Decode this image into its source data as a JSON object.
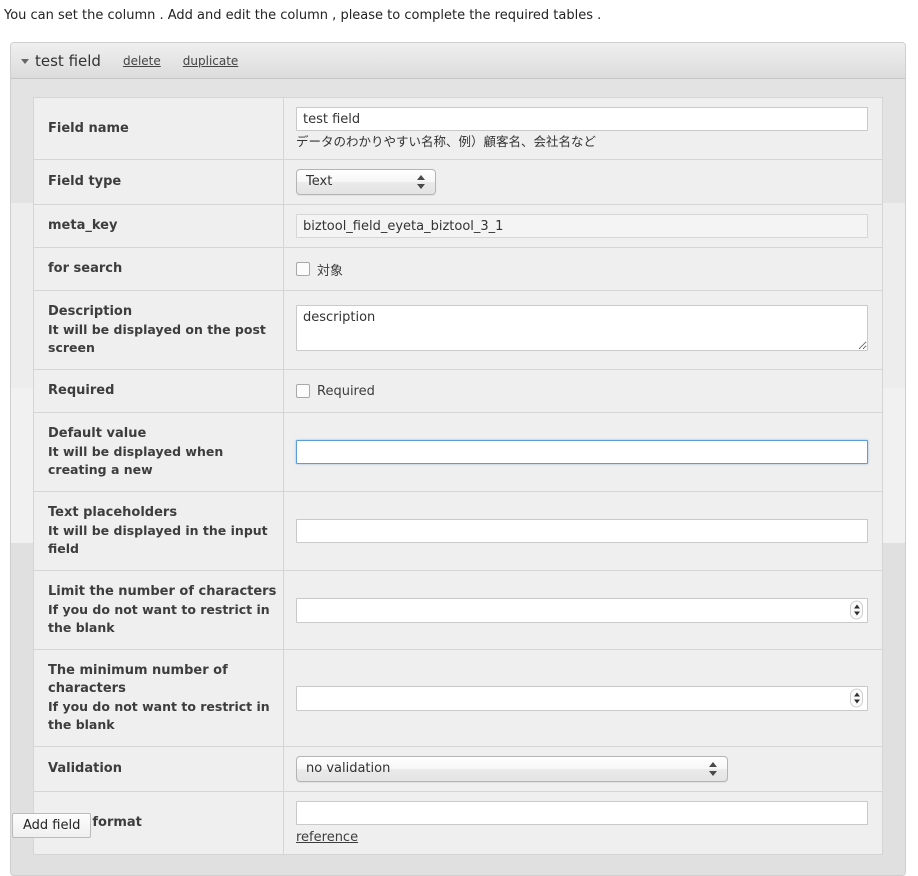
{
  "intro": "You can set the column . Add and edit the column , please to complete the required tables .",
  "panel": {
    "title": "test field",
    "delete_label": "delete",
    "duplicate_label": "duplicate"
  },
  "rows": {
    "field_name": {
      "label": "Field name",
      "value": "test field",
      "helper": "データのわかりやすい名称、例）顧客名、会社名など"
    },
    "field_type": {
      "label": "Field type",
      "selected": "Text"
    },
    "meta_key": {
      "label": "meta_key",
      "value": "biztool_field_eyeta_biztool_3_1"
    },
    "for_search": {
      "label": "for search",
      "checkbox_label": "対象",
      "checked": false
    },
    "description": {
      "label": "Description",
      "sub": "It will be displayed on the post screen",
      "value": "description"
    },
    "required": {
      "label": "Required",
      "checkbox_label": "Required",
      "checked": false
    },
    "default_value": {
      "label": "Default value",
      "sub": "It will be displayed when creating a new",
      "value": "",
      "focused": true
    },
    "text_placeholders": {
      "label": "Text placeholders",
      "sub": "It will be displayed in the input field",
      "value": ""
    },
    "limit_characters": {
      "label": "Limit the number of characters",
      "sub": "If you do not want to restrict in the blank",
      "value": ""
    },
    "minimum_characters": {
      "label": "The minimum number of characters",
      "sub": "If you do not want to restrict in the blank",
      "value": ""
    },
    "validation": {
      "label": "Validation",
      "selected": "no validation"
    },
    "fixed_format": {
      "label": "Fixed format",
      "value": "",
      "reference_label": "reference"
    }
  },
  "footer": {
    "add_field_label": "Add field"
  },
  "colors": {
    "focus_border": "#5b9dd9",
    "panel_bg": "#e6e6e6",
    "table_bg": "#efefef"
  }
}
